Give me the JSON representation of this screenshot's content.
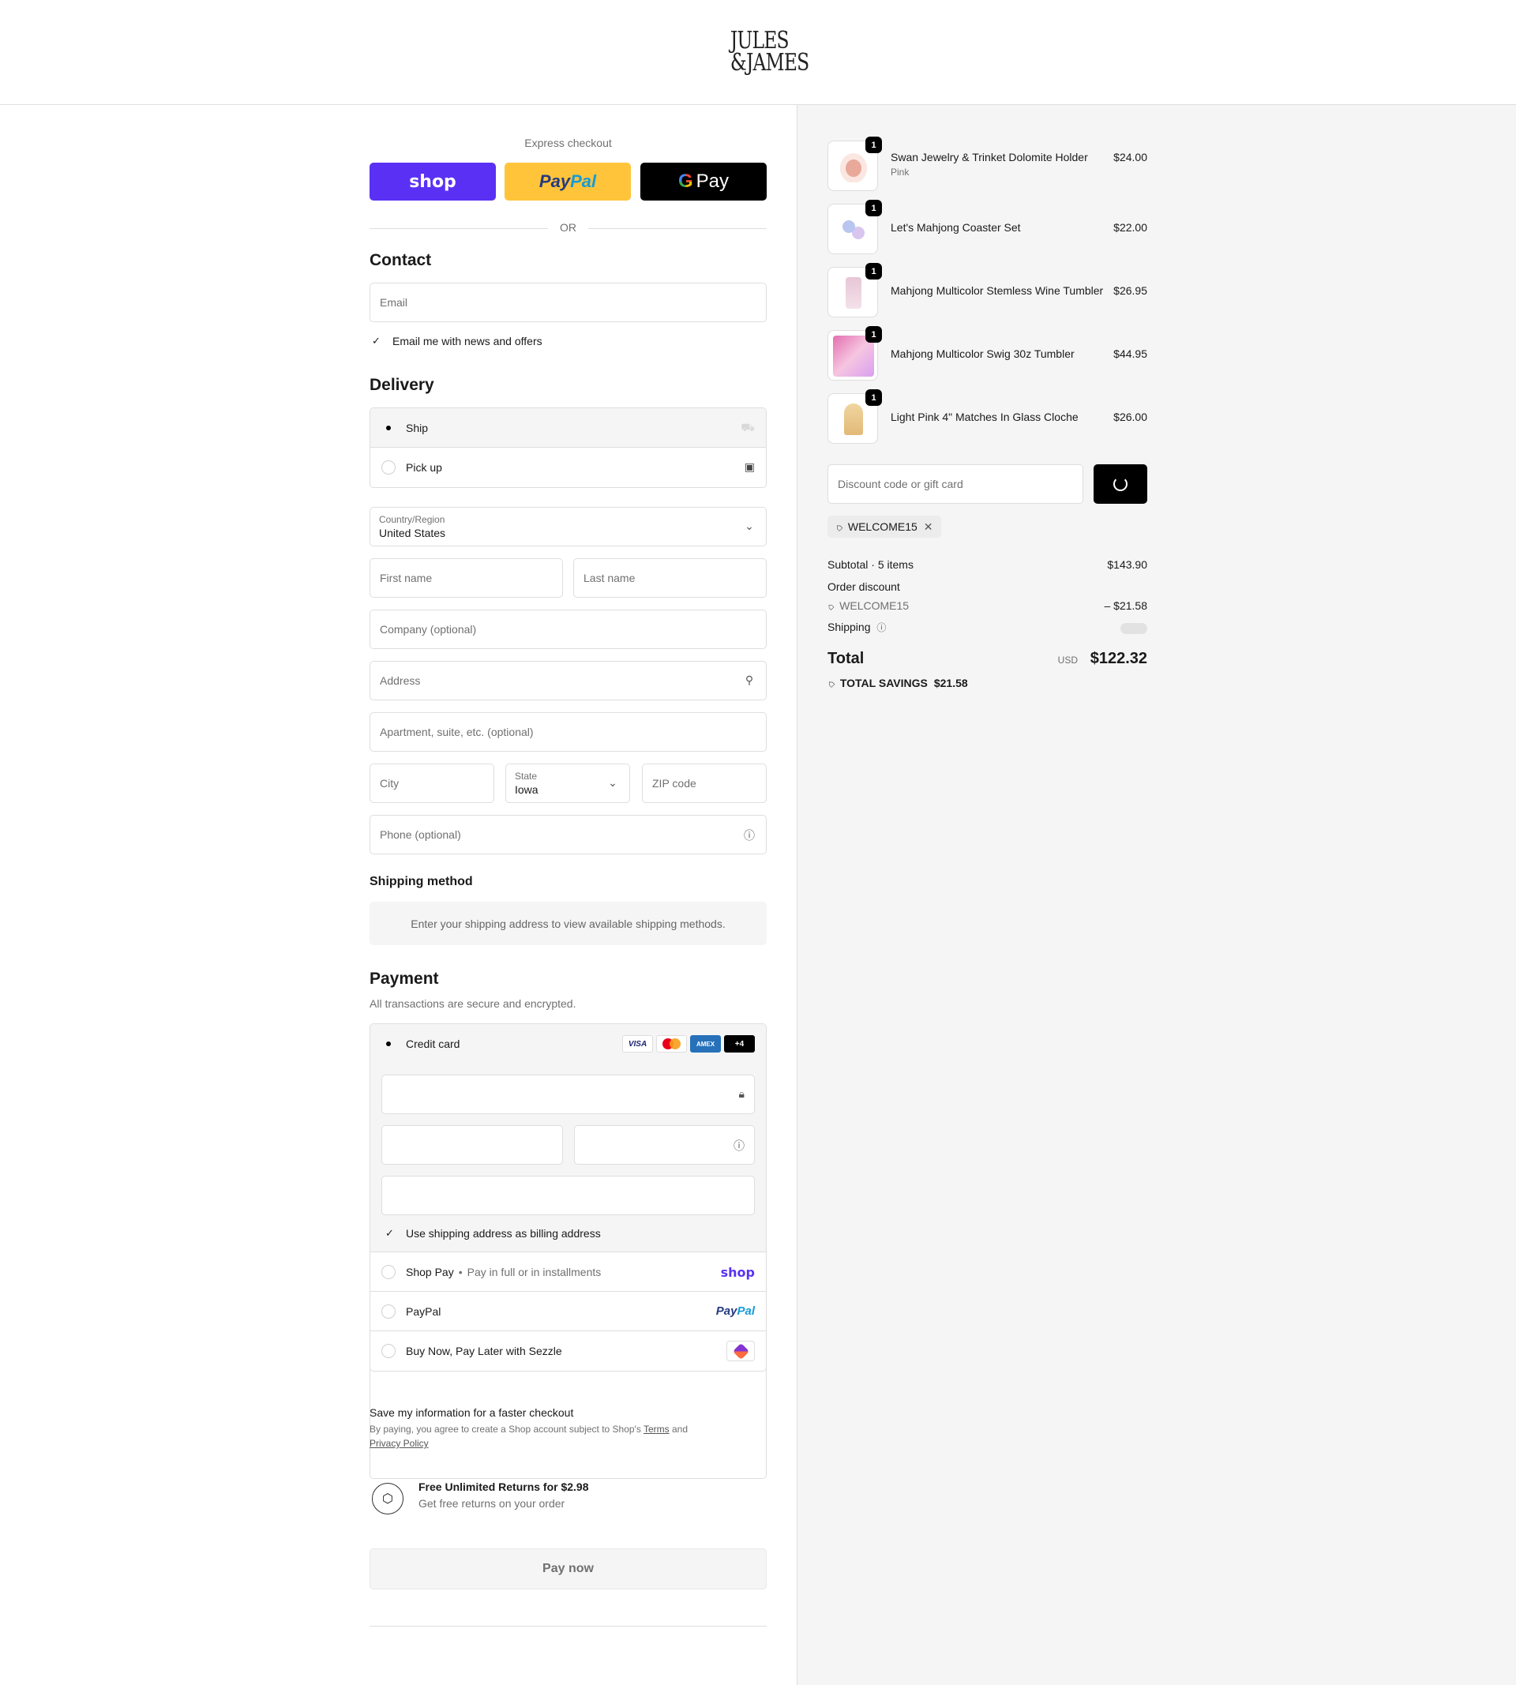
{
  "brand": {
    "line1": "JULES",
    "line2": "&JAMES"
  },
  "express": {
    "title": "Express checkout",
    "shop_label": "shop",
    "paypal_label_1": "Pay",
    "paypal_label_2": "Pal",
    "gpay_g": "G",
    "gpay_label": "Pay",
    "or": "OR"
  },
  "contact": {
    "heading": "Contact",
    "email_placeholder": "Email",
    "news_check": "✓",
    "news_label": "Email me with news and offers"
  },
  "delivery": {
    "heading": "Delivery",
    "options": [
      {
        "label": "Ship",
        "selected": true
      },
      {
        "label": "Pick up",
        "selected": false
      }
    ],
    "country_label": "Country/Region",
    "country_value": "United States",
    "first_name": "First name",
    "last_name": "Last name",
    "company": "Company (optional)",
    "address": "Address",
    "apartment": "Apartment, suite, etc. (optional)",
    "city": "City",
    "state_label": "State",
    "state_value": "Iowa",
    "zip": "ZIP code",
    "phone": "Phone (optional)"
  },
  "shipping_method": {
    "heading": "Shipping method",
    "note": "Enter your shipping address to view available shipping methods."
  },
  "payment": {
    "heading": "Payment",
    "subtitle": "All transactions are secure and encrypted.",
    "credit_card_label": "Credit card",
    "card_badges": [
      "VISA",
      "AMEX",
      "+4"
    ],
    "billing_check": "✓",
    "billing_label": "Use shipping address as billing address",
    "shop_pay_label": "Shop Pay",
    "shop_pay_sep": "•",
    "shop_pay_sub": "Pay in full or in installments",
    "shop_pay_brand": "shop",
    "paypal_label": "PayPal",
    "paypal_brand_1": "Pay",
    "paypal_brand_2": "Pal",
    "sezzle_label": "Buy Now, Pay Later with Sezzle"
  },
  "save_info": {
    "title": "Save my information for a faster checkout",
    "text_1": "By paying, you agree to create a Shop account subject to Shop's",
    "terms": "Terms",
    "and": "and",
    "privacy": "Privacy Policy"
  },
  "returns": {
    "title": "Free Unlimited Returns for $2.98",
    "subtitle": "Get free returns on your order"
  },
  "pay_now": "Pay now",
  "cart": {
    "items": [
      {
        "name": "Swan Jewelry & Trinket Dolomite Holder",
        "variant": "Pink",
        "price": "$24.00",
        "qty": "1",
        "color": "#f3c2b6"
      },
      {
        "name": "Let's Mahjong Coaster Set",
        "variant": "",
        "price": "$22.00",
        "qty": "1",
        "color": "#c9d4f0"
      },
      {
        "name": "Mahjong Multicolor Stemless Wine Tumbler",
        "variant": "",
        "price": "$26.95",
        "qty": "1",
        "color": "#e8c9d8"
      },
      {
        "name": "Mahjong Multicolor Swig 30z Tumbler",
        "variant": "",
        "price": "$44.95",
        "qty": "1",
        "color": "#e48fc0"
      },
      {
        "name": "Light Pink 4\" Matches In Glass Cloche",
        "variant": "",
        "price": "$26.00",
        "qty": "1",
        "color": "#e8c98f"
      }
    ],
    "discount_placeholder": "Discount code or gift card",
    "applied_code": "WELCOME15",
    "subtotal_label": "Subtotal · 5 items",
    "subtotal_value": "$143.90",
    "order_discount_label": "Order discount",
    "order_discount_code": "WELCOME15",
    "order_discount_value": "– $21.58",
    "shipping_label": "Shipping",
    "total_label": "Total",
    "currency": "USD",
    "total_value": "$122.32",
    "savings_label": "TOTAL SAVINGS",
    "savings_value": "$21.58"
  }
}
